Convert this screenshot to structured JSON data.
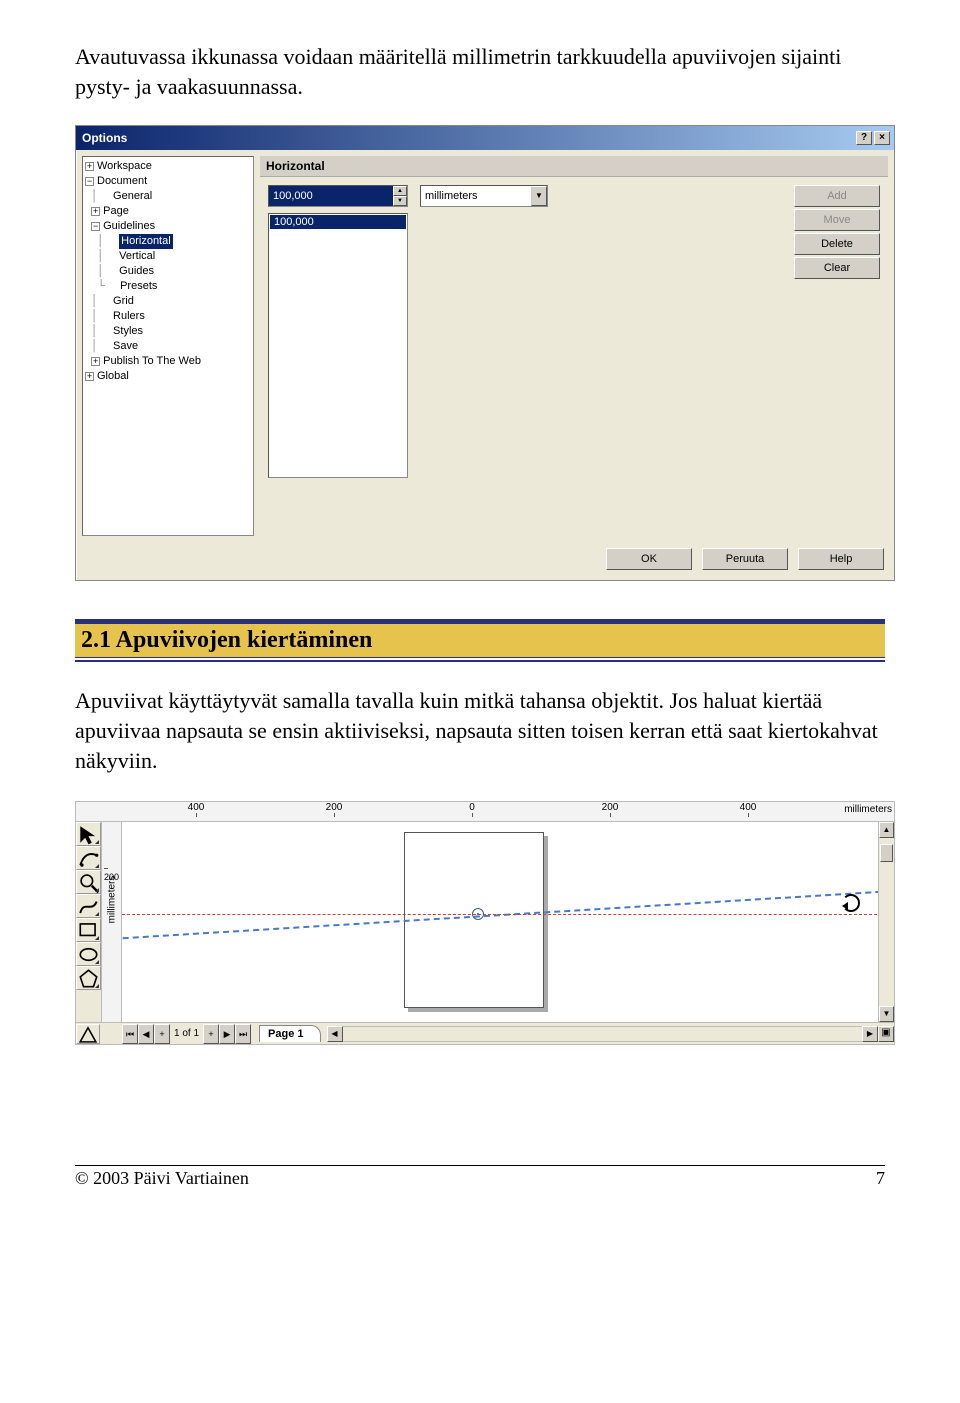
{
  "intro": "Avautuvassa ikkunassa voidaan määritellä millimetrin tarkkuudella apuviivojen sijainti pysty- ja vaakasuunnassa.",
  "dialog": {
    "title": "Options",
    "help_btn": "?",
    "close_btn": "×",
    "tree": {
      "workspace": "Workspace",
      "document": "Document",
      "general": "General",
      "page": "Page",
      "guidelines": "Guidelines",
      "horizontal": "Horizontal",
      "vertical": "Vertical",
      "guides": "Guides",
      "presets": "Presets",
      "grid": "Grid",
      "rulers": "Rulers",
      "styles": "Styles",
      "save": "Save",
      "publish": "Publish To The Web",
      "global": "Global"
    },
    "panel_title": "Horizontal",
    "entry_value": "100,000",
    "units": "millimeters",
    "list_selected": "100,000",
    "buttons": {
      "add": "Add",
      "move": "Move",
      "delete": "Delete",
      "clear": "Clear"
    },
    "bottom": {
      "ok": "OK",
      "cancel": "Peruuta",
      "help": "Help"
    }
  },
  "section_heading": "2.1 Apuviivojen kiertäminen",
  "body2": "Apuviivat käyttäytyvät samalla tavalla kuin mitkä tahansa objektit. Jos haluat kiertää apuviivaa napsauta se ensin aktiiviseksi, napsauta sitten toisen kerran että saat kiertokahvat näkyviin.",
  "canvas": {
    "ruler_ticks": [
      "400",
      "200",
      "0",
      "200",
      "400"
    ],
    "ruler_unit": "millimeters",
    "vtick": "200",
    "vlabel": "millimeters",
    "page_of": "1 of 1",
    "tab_label": "Page 1"
  },
  "footer": {
    "left": "© 2003 Päivi Vartiainen",
    "right": "7"
  }
}
